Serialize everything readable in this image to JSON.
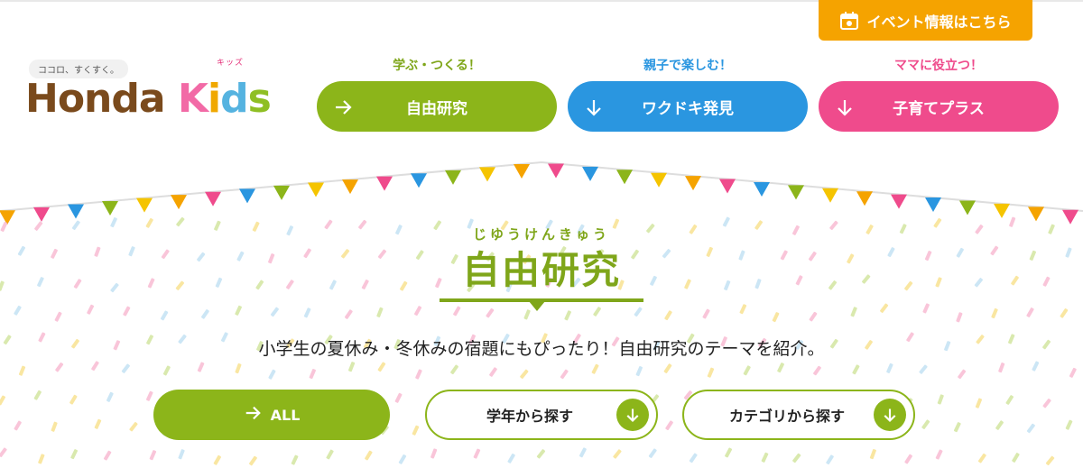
{
  "header": {
    "event_button": {
      "label": "イベント情報はこちら",
      "icon": "calendar-icon",
      "color": "#f5a300"
    }
  },
  "logo": {
    "tagline": "ココロ、すくすく。",
    "kana": "キッズ",
    "main_left": "Honda",
    "main_right_letters": [
      "K",
      "i",
      "d",
      "s"
    ]
  },
  "nav": [
    {
      "caption": "学ぶ・つくる！",
      "label": "自由研究",
      "color": "#8cb51a",
      "caption_color": "#7fa61a",
      "icon": "arrow-right-icon"
    },
    {
      "caption": "親子で楽しむ！",
      "label": "ワクドキ発見",
      "color": "#2a96e0",
      "caption_color": "#2a96e0",
      "icon": "arrow-down-icon"
    },
    {
      "caption": "ママに役立つ！",
      "label": "子育てプラス",
      "color": "#ef4b8c",
      "caption_color": "#ef4b8c",
      "icon": "arrow-down-icon"
    }
  ],
  "hero": {
    "ruby": "じゆうけんきゅう",
    "title": "自由研究",
    "lead": "小学生の夏休み・冬休みの宿題にもぴったり！自由研究のテーマを紹介。"
  },
  "buttons": {
    "all": "ALL",
    "by_grade": "学年から探す",
    "by_category": "カテゴリから探す"
  },
  "bunting_colors": [
    "#f5a300",
    "#ef4b8c",
    "#2a96e0",
    "#8cb51a",
    "#f5c400"
  ]
}
